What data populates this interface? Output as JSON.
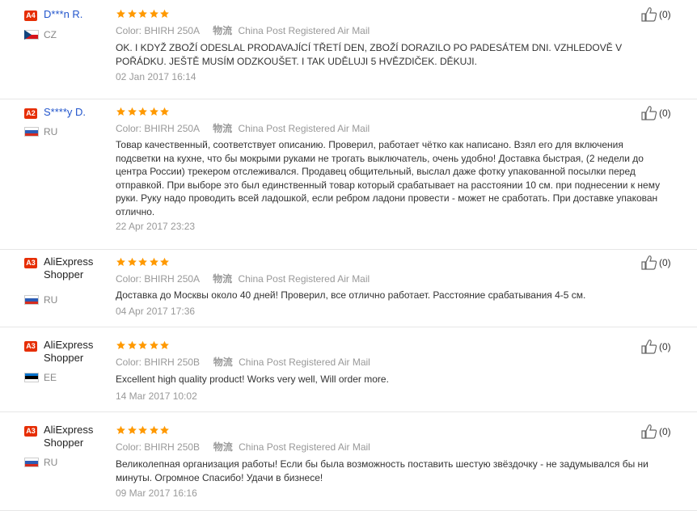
{
  "colors": {
    "accent": "#e62e04",
    "link": "#2255cc",
    "star": "#ff9900"
  },
  "reviews": [
    {
      "level": "A4",
      "name": "D***n R.",
      "country": "CZ",
      "stars": 5,
      "color_label": "Color:",
      "color_value": "BHIRH 250A",
      "logistics_icon": "物流",
      "logistics_value": "China Post Registered Air Mail",
      "text": "OK. I KDYŽ ZBOŽÍ ODESLAL PRODAVAJÍCÍ TŘETÍ DEN, ZBOŽÍ DORAZILO PO PADESÁTEM DNI. VZHLEDOVĚ V POŘÁDKU. JEŠTĚ MUSÍM ODZKOUŠET. I TAK UDĚLUJI 5 HVĚZDIČEK. DĚKUJI.",
      "date": "02 Jan 2017 16:14",
      "likes": "(0)"
    },
    {
      "level": "A2",
      "name": "S****y D.",
      "country": "RU",
      "stars": 5,
      "color_label": "Color:",
      "color_value": "BHIRH 250A",
      "logistics_icon": "物流",
      "logistics_value": "China Post Registered Air Mail",
      "text": "Товар качественный, соответствует описанию. Проверил, работает чётко как написано. Взял его для включения подсветки на кухне, что бы мокрыми руками не трогать выключатель, очень удобно! Доставка быстрая, (2 недели до центра России) трекером отслеживался. Продавец общительный, выслал даже фотку упакованной посылки перед отправкой. При выборе это был единственный товар который срабатывает на расстоянии 10 см. при поднесении к нему руки. Руку надо проводить всей ладошкой, если ребром ладони провести - может не сработать. При доставке упакован отлично.",
      "date": "22 Apr 2017 23:23",
      "likes": "(0)"
    },
    {
      "level": "A3",
      "name": "AliExpress Shopper",
      "country": "RU",
      "stars": 5,
      "color_label": "Color:",
      "color_value": "BHIRH 250A",
      "logistics_icon": "物流",
      "logistics_value": "China Post Registered Air Mail",
      "text": "Доставка до Москвы около 40 дней! Проверил, все отлично работает. Расстояние срабатывания 4-5 см.",
      "date": "04 Apr 2017 17:36",
      "likes": "(0)"
    },
    {
      "level": "A3",
      "name": "AliExpress Shopper",
      "country": "EE",
      "stars": 5,
      "color_label": "Color:",
      "color_value": "BHIRH 250B",
      "logistics_icon": "物流",
      "logistics_value": "China Post Registered Air Mail",
      "text": "Excellent high quality product! Works very well, Will order more.",
      "date": "14 Mar 2017 10:02",
      "likes": "(0)"
    },
    {
      "level": "A3",
      "name": "AliExpress Shopper",
      "country": "RU",
      "stars": 5,
      "color_label": "Color:",
      "color_value": "BHIRH 250B",
      "logistics_icon": "物流",
      "logistics_value": "China Post Registered Air Mail",
      "text": "Великолепная организация работы! Если бы была возможность поставить шестую звёздочку - не задумывался бы ни минуты. Огромное Спасибо! Удачи в бизнесе!",
      "date": "09 Mar 2017 16:16",
      "likes": "(0)"
    }
  ]
}
